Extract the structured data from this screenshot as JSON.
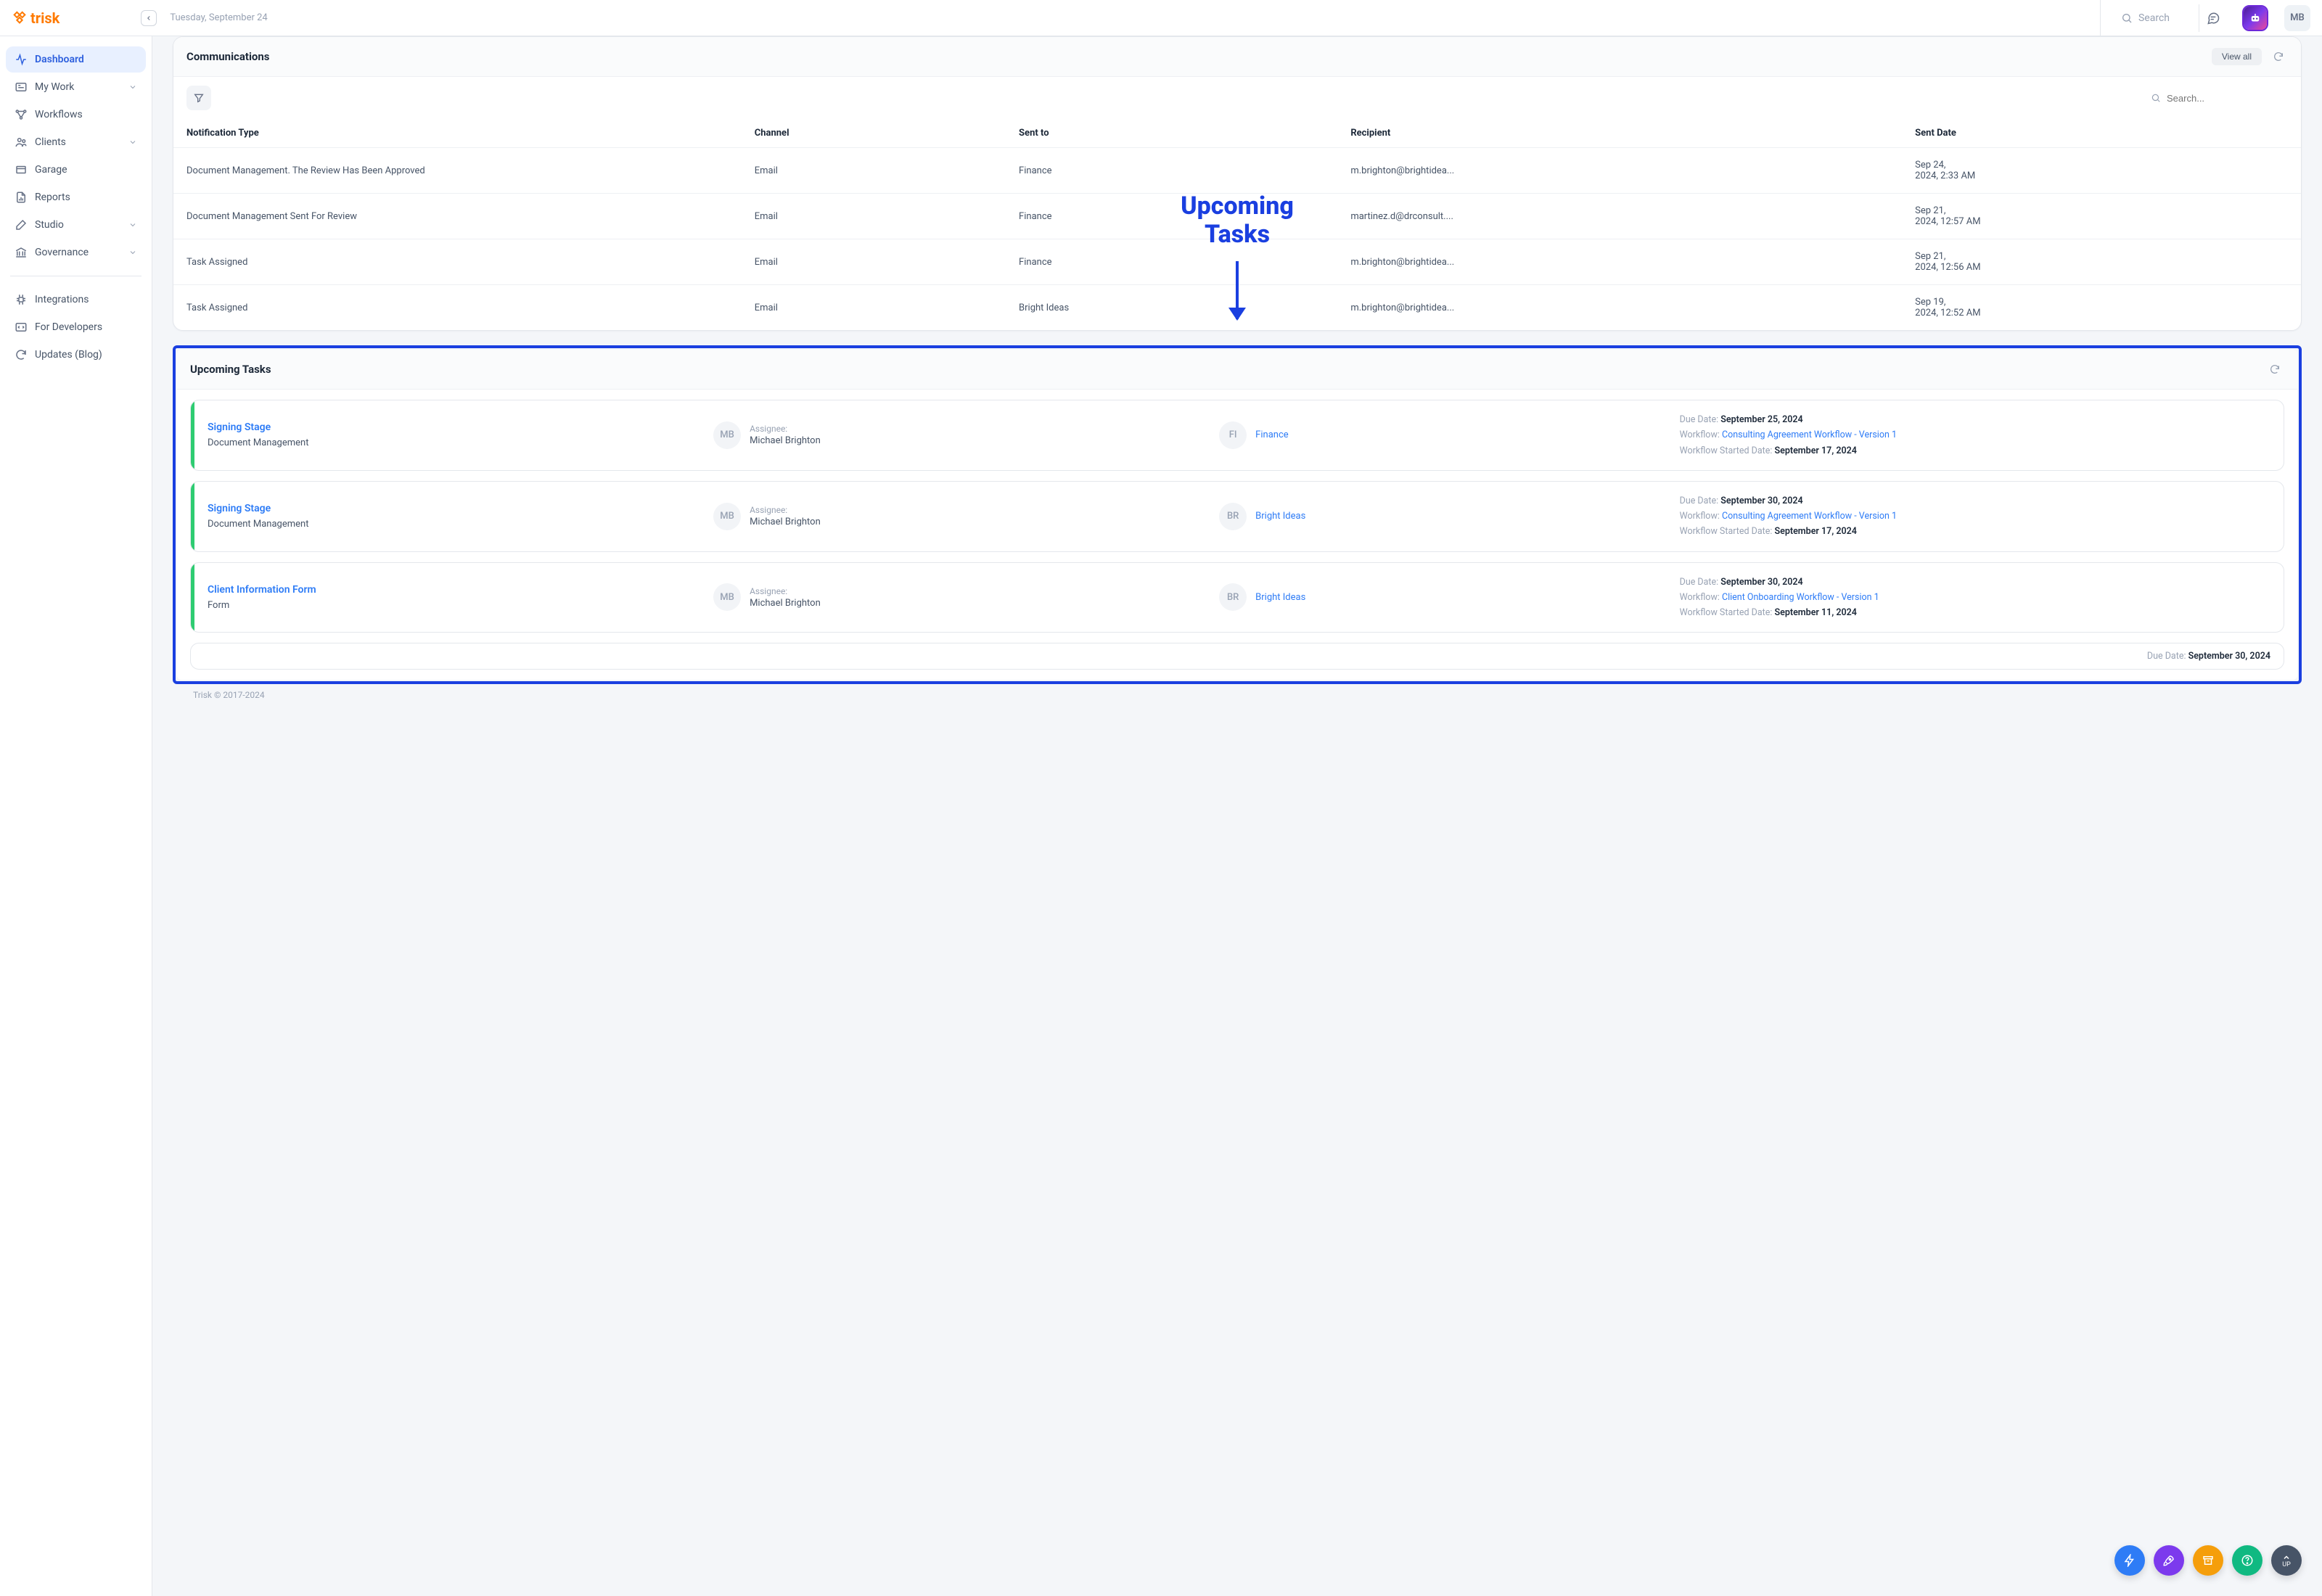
{
  "brand": "trisk",
  "topbar": {
    "date": "Tuesday, September 24",
    "search_placeholder": "Search",
    "avatar_initials": "MB"
  },
  "sidebar": {
    "items": [
      {
        "label": "Dashboard"
      },
      {
        "label": "My Work"
      },
      {
        "label": "Workflows"
      },
      {
        "label": "Clients"
      },
      {
        "label": "Garage"
      },
      {
        "label": "Reports"
      },
      {
        "label": "Studio"
      },
      {
        "label": "Governance"
      }
    ],
    "secondary": [
      {
        "label": "Integrations"
      },
      {
        "label": "For Developers"
      },
      {
        "label": "Updates (Blog)"
      }
    ]
  },
  "communications": {
    "title": "Communications",
    "view_all": "View all",
    "search_placeholder": "Search...",
    "columns": [
      "Notification Type",
      "Channel",
      "Sent to",
      "Recipient",
      "Sent Date"
    ],
    "rows": [
      {
        "type": "Document Management. The Review Has Been Approved",
        "channel": "Email",
        "sent_to": "Finance",
        "recipient": "m.brighton@brightidea...",
        "date": "Sep 24, 2024, 2:33 AM"
      },
      {
        "type": "Document Management Sent For Review",
        "channel": "Email",
        "sent_to": "Finance",
        "recipient": "martinez.d@drconsult....",
        "date": "Sep 21, 2024, 12:57 AM"
      },
      {
        "type": "Task Assigned",
        "channel": "Email",
        "sent_to": "Finance",
        "recipient": "m.brighton@brightidea...",
        "date": "Sep 21, 2024, 12:56 AM"
      },
      {
        "type": "Task Assigned",
        "channel": "Email",
        "sent_to": "Bright Ideas",
        "recipient": "m.brighton@brightidea...",
        "date": "Sep 19, 2024, 12:52 AM"
      }
    ]
  },
  "upcoming": {
    "title": "Upcoming Tasks",
    "labels": {
      "assignee": "Assignee:",
      "due": "Due Date:",
      "workflow": "Workflow:",
      "started": "Workflow Started Date:"
    },
    "tasks": [
      {
        "name": "Signing Stage",
        "type": "Document Management",
        "assignee_initials": "MB",
        "assignee": "Michael Brighton",
        "client_initials": "FI",
        "client": "Finance",
        "due": "September 25, 2024",
        "workflow": "Consulting Agreement Workflow - Version 1",
        "started": "September 17, 2024"
      },
      {
        "name": "Signing Stage",
        "type": "Document Management",
        "assignee_initials": "MB",
        "assignee": "Michael Brighton",
        "client_initials": "BR",
        "client": "Bright Ideas",
        "due": "September 30, 2024",
        "workflow": "Consulting Agreement Workflow - Version 1",
        "started": "September 17, 2024"
      },
      {
        "name": "Client Information Form",
        "type": "Form",
        "assignee_initials": "MB",
        "assignee": "Michael Brighton",
        "client_initials": "BR",
        "client": "Bright Ideas",
        "due": "September 30, 2024",
        "workflow": "Client Onboarding Workflow - Version 1",
        "started": "September 11, 2024"
      }
    ],
    "peek_due": "September 30, 2024"
  },
  "annotation": "Upcoming\nTasks",
  "fab_up": "UP",
  "footer": "Trisk © 2017-2024"
}
